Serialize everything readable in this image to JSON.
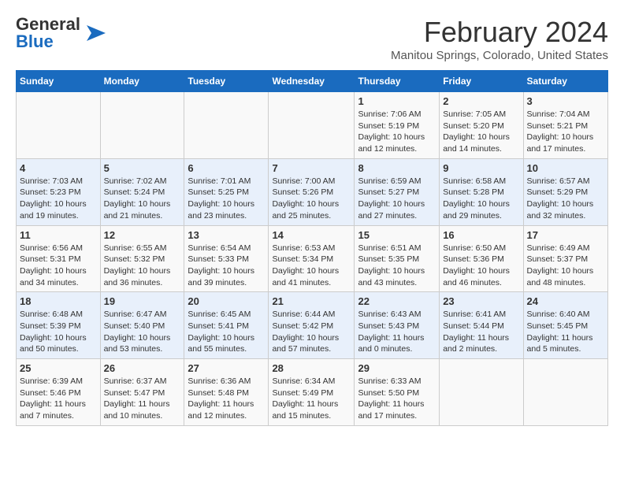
{
  "header": {
    "logo_line1": "General",
    "logo_line2": "Blue",
    "month_title": "February 2024",
    "location": "Manitou Springs, Colorado, United States"
  },
  "weekdays": [
    "Sunday",
    "Monday",
    "Tuesday",
    "Wednesday",
    "Thursday",
    "Friday",
    "Saturday"
  ],
  "weeks": [
    [
      {
        "day": "",
        "info": ""
      },
      {
        "day": "",
        "info": ""
      },
      {
        "day": "",
        "info": ""
      },
      {
        "day": "",
        "info": ""
      },
      {
        "day": "1",
        "info": "Sunrise: 7:06 AM\nSunset: 5:19 PM\nDaylight: 10 hours\nand 12 minutes."
      },
      {
        "day": "2",
        "info": "Sunrise: 7:05 AM\nSunset: 5:20 PM\nDaylight: 10 hours\nand 14 minutes."
      },
      {
        "day": "3",
        "info": "Sunrise: 7:04 AM\nSunset: 5:21 PM\nDaylight: 10 hours\nand 17 minutes."
      }
    ],
    [
      {
        "day": "4",
        "info": "Sunrise: 7:03 AM\nSunset: 5:23 PM\nDaylight: 10 hours\nand 19 minutes."
      },
      {
        "day": "5",
        "info": "Sunrise: 7:02 AM\nSunset: 5:24 PM\nDaylight: 10 hours\nand 21 minutes."
      },
      {
        "day": "6",
        "info": "Sunrise: 7:01 AM\nSunset: 5:25 PM\nDaylight: 10 hours\nand 23 minutes."
      },
      {
        "day": "7",
        "info": "Sunrise: 7:00 AM\nSunset: 5:26 PM\nDaylight: 10 hours\nand 25 minutes."
      },
      {
        "day": "8",
        "info": "Sunrise: 6:59 AM\nSunset: 5:27 PM\nDaylight: 10 hours\nand 27 minutes."
      },
      {
        "day": "9",
        "info": "Sunrise: 6:58 AM\nSunset: 5:28 PM\nDaylight: 10 hours\nand 29 minutes."
      },
      {
        "day": "10",
        "info": "Sunrise: 6:57 AM\nSunset: 5:29 PM\nDaylight: 10 hours\nand 32 minutes."
      }
    ],
    [
      {
        "day": "11",
        "info": "Sunrise: 6:56 AM\nSunset: 5:31 PM\nDaylight: 10 hours\nand 34 minutes."
      },
      {
        "day": "12",
        "info": "Sunrise: 6:55 AM\nSunset: 5:32 PM\nDaylight: 10 hours\nand 36 minutes."
      },
      {
        "day": "13",
        "info": "Sunrise: 6:54 AM\nSunset: 5:33 PM\nDaylight: 10 hours\nand 39 minutes."
      },
      {
        "day": "14",
        "info": "Sunrise: 6:53 AM\nSunset: 5:34 PM\nDaylight: 10 hours\nand 41 minutes."
      },
      {
        "day": "15",
        "info": "Sunrise: 6:51 AM\nSunset: 5:35 PM\nDaylight: 10 hours\nand 43 minutes."
      },
      {
        "day": "16",
        "info": "Sunrise: 6:50 AM\nSunset: 5:36 PM\nDaylight: 10 hours\nand 46 minutes."
      },
      {
        "day": "17",
        "info": "Sunrise: 6:49 AM\nSunset: 5:37 PM\nDaylight: 10 hours\nand 48 minutes."
      }
    ],
    [
      {
        "day": "18",
        "info": "Sunrise: 6:48 AM\nSunset: 5:39 PM\nDaylight: 10 hours\nand 50 minutes."
      },
      {
        "day": "19",
        "info": "Sunrise: 6:47 AM\nSunset: 5:40 PM\nDaylight: 10 hours\nand 53 minutes."
      },
      {
        "day": "20",
        "info": "Sunrise: 6:45 AM\nSunset: 5:41 PM\nDaylight: 10 hours\nand 55 minutes."
      },
      {
        "day": "21",
        "info": "Sunrise: 6:44 AM\nSunset: 5:42 PM\nDaylight: 10 hours\nand 57 minutes."
      },
      {
        "day": "22",
        "info": "Sunrise: 6:43 AM\nSunset: 5:43 PM\nDaylight: 11 hours\nand 0 minutes."
      },
      {
        "day": "23",
        "info": "Sunrise: 6:41 AM\nSunset: 5:44 PM\nDaylight: 11 hours\nand 2 minutes."
      },
      {
        "day": "24",
        "info": "Sunrise: 6:40 AM\nSunset: 5:45 PM\nDaylight: 11 hours\nand 5 minutes."
      }
    ],
    [
      {
        "day": "25",
        "info": "Sunrise: 6:39 AM\nSunset: 5:46 PM\nDaylight: 11 hours\nand 7 minutes."
      },
      {
        "day": "26",
        "info": "Sunrise: 6:37 AM\nSunset: 5:47 PM\nDaylight: 11 hours\nand 10 minutes."
      },
      {
        "day": "27",
        "info": "Sunrise: 6:36 AM\nSunset: 5:48 PM\nDaylight: 11 hours\nand 12 minutes."
      },
      {
        "day": "28",
        "info": "Sunrise: 6:34 AM\nSunset: 5:49 PM\nDaylight: 11 hours\nand 15 minutes."
      },
      {
        "day": "29",
        "info": "Sunrise: 6:33 AM\nSunset: 5:50 PM\nDaylight: 11 hours\nand 17 minutes."
      },
      {
        "day": "",
        "info": ""
      },
      {
        "day": "",
        "info": ""
      }
    ]
  ]
}
